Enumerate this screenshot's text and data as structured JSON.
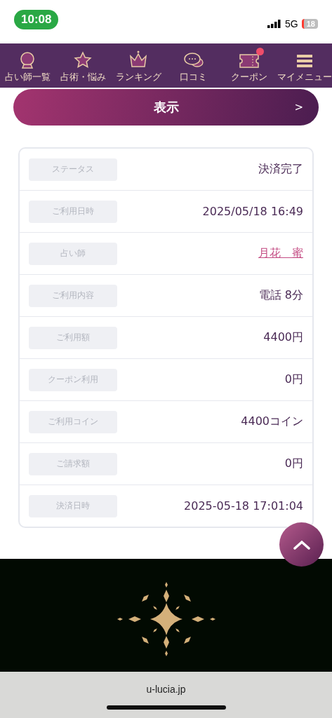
{
  "status_bar": {
    "time": "10:08",
    "network": "5G",
    "battery": "18"
  },
  "nav": [
    {
      "label": "占い師一覧",
      "badge": false
    },
    {
      "label": "占術・悩み",
      "badge": false
    },
    {
      "label": "ランキング",
      "badge": false
    },
    {
      "label": "口コミ",
      "badge": false
    },
    {
      "label": "クーポン",
      "badge": true
    },
    {
      "label": "マイメニュー",
      "badge": false
    }
  ],
  "show_button": {
    "label": "表示",
    "arrow": ">"
  },
  "details": [
    {
      "label": "ステータス",
      "value": "決済完了",
      "kind": "text"
    },
    {
      "label": "ご利用日時",
      "value": "2025/05/18 16:49",
      "kind": "text"
    },
    {
      "label": "占い師",
      "value": "月花　蜜",
      "kind": "link"
    },
    {
      "label": "ご利用内容",
      "value": "電話 8分",
      "kind": "text"
    },
    {
      "label": "ご利用額",
      "value": "4400円",
      "kind": "text"
    },
    {
      "label": "クーポン利用",
      "value": "0円",
      "kind": "text"
    },
    {
      "label": "ご利用コイン",
      "value": "4400コイン",
      "kind": "text"
    },
    {
      "label": "ご請求額",
      "value": "0円",
      "kind": "text"
    },
    {
      "label": "決済日時",
      "value": "2025-05-18 17:01:04",
      "kind": "text"
    }
  ],
  "browser": {
    "url": "u-lucia.jp"
  }
}
